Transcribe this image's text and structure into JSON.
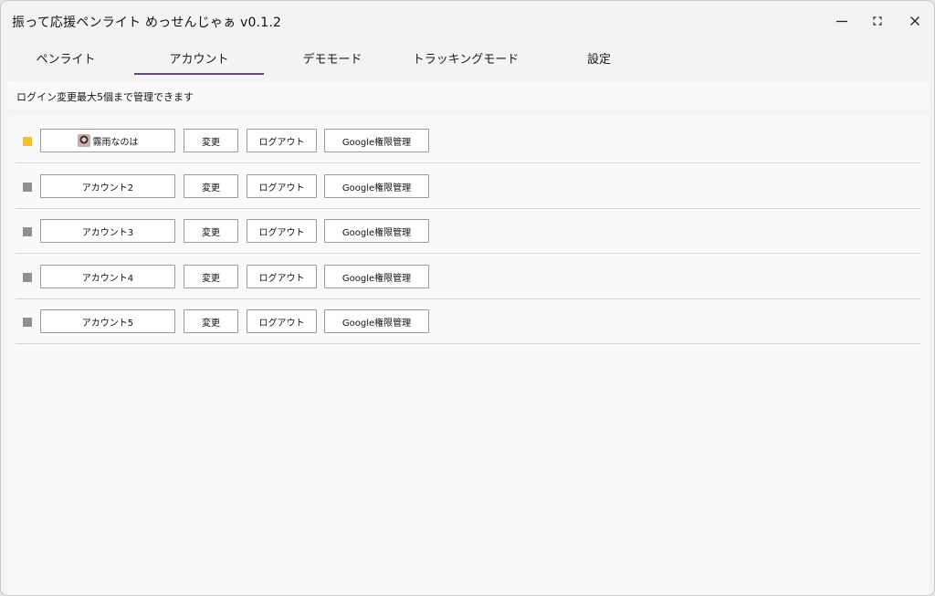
{
  "window": {
    "title": "振って応援ペンライト めっせんじゃぁ v0.1.2",
    "controls": {
      "minimize_icon": "minimize-icon",
      "maximize_icon": "maximize-icon",
      "close_icon": "close-icon"
    }
  },
  "tabs": [
    {
      "label": "ペンライト",
      "active": false
    },
    {
      "label": "アカウント",
      "active": true
    },
    {
      "label": "デモモード",
      "active": false
    },
    {
      "label": "トラッキングモード",
      "active": false
    },
    {
      "label": "設定",
      "active": false
    }
  ],
  "info": {
    "login_label": "ログイン変更",
    "max_note": "最大5個まで管理できます"
  },
  "colors": {
    "accent": "#5c4a7a",
    "active_indicator": "#f2c12e",
    "inactive_indicator": "#8a9294"
  },
  "accounts": [
    {
      "name": "霧雨なのは",
      "has_avatar": true,
      "active": true,
      "change_label": "変更",
      "logout_label": "ログアウト",
      "google_label": "Google権限管理"
    },
    {
      "name": "アカウント2",
      "has_avatar": false,
      "active": false,
      "change_label": "変更",
      "logout_label": "ログアウト",
      "google_label": "Google権限管理"
    },
    {
      "name": "アカウント3",
      "has_avatar": false,
      "active": false,
      "change_label": "変更",
      "logout_label": "ログアウト",
      "google_label": "Google権限管理"
    },
    {
      "name": "アカウント4",
      "has_avatar": false,
      "active": false,
      "change_label": "変更",
      "logout_label": "ログアウト",
      "google_label": "Google権限管理"
    },
    {
      "name": "アカウント5",
      "has_avatar": false,
      "active": false,
      "change_label": "変更",
      "logout_label": "ログアウト",
      "google_label": "Google権限管理"
    }
  ]
}
